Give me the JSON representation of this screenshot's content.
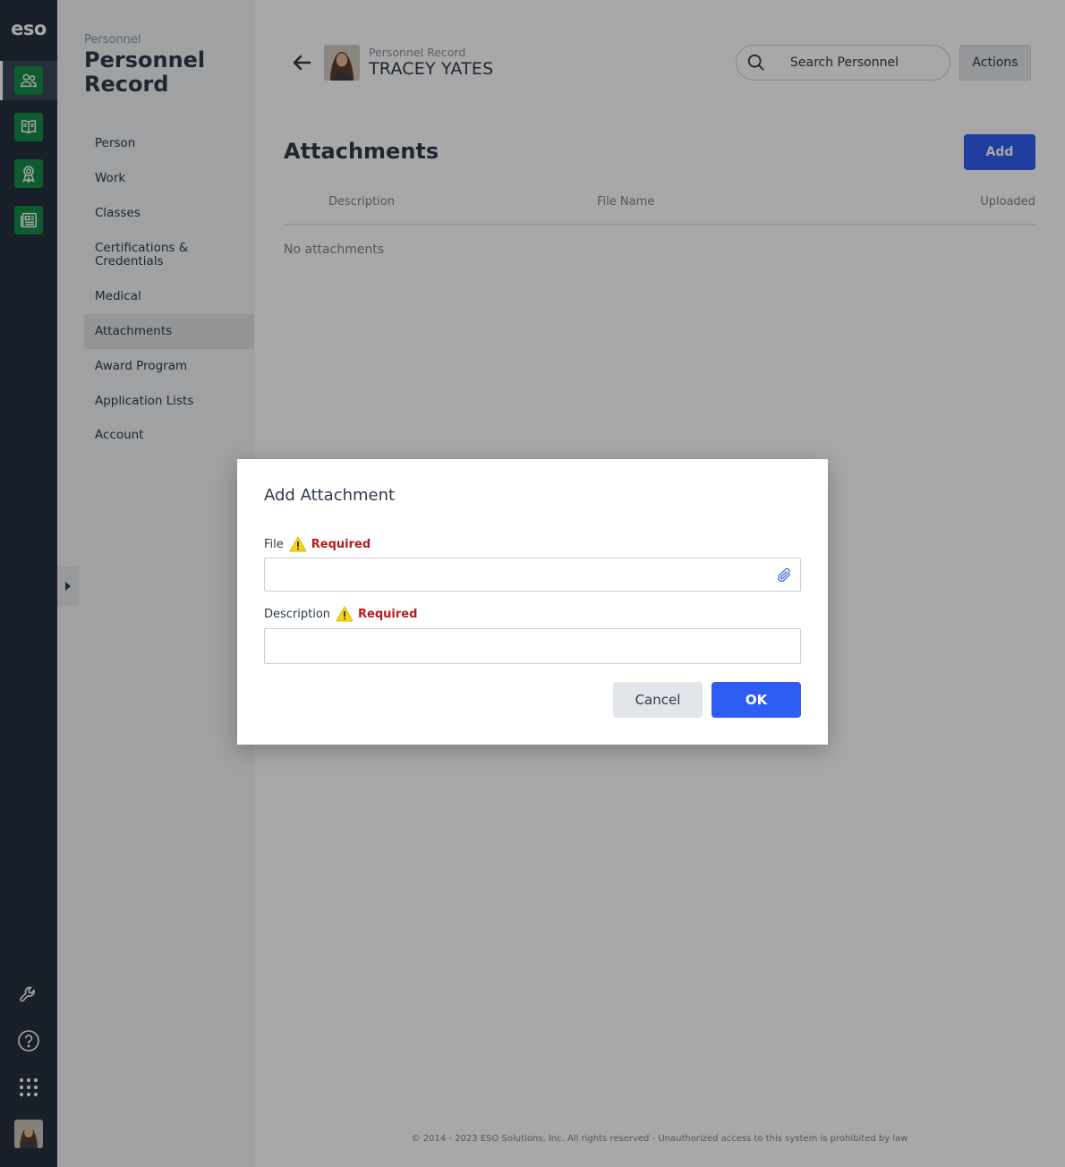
{
  "app": {
    "logo_text": "eso"
  },
  "rail": {
    "items": [
      {
        "icon": "people-icon",
        "active": true
      },
      {
        "icon": "book-icon",
        "active": false
      },
      {
        "icon": "award-icon",
        "active": false
      },
      {
        "icon": "news-icon",
        "active": false
      }
    ],
    "bottom": [
      "wrench-icon",
      "help-icon",
      "apps-grid-icon",
      "user-avatar"
    ]
  },
  "subnav": {
    "eyebrow": "Personnel",
    "title": "Personnel Record",
    "items": [
      {
        "label": "Person"
      },
      {
        "label": "Work"
      },
      {
        "label": "Classes"
      },
      {
        "label": "Certifications & Credentials"
      },
      {
        "label": "Medical"
      },
      {
        "label": "Attachments",
        "active": true
      },
      {
        "label": "Award Program"
      },
      {
        "label": "Application Lists"
      },
      {
        "label": "Account"
      }
    ]
  },
  "header": {
    "eyebrow": "Personnel Record",
    "name": "TRACEY YATES",
    "search_placeholder": "Search Personnel",
    "actions_label": "Actions"
  },
  "main": {
    "title": "Attachments",
    "add_label": "Add",
    "columns": [
      "Description",
      "File Name",
      "Uploaded"
    ],
    "empty_text": "No attachments"
  },
  "footer": {
    "text": "© 2014 - 2023 ESO Solutions, Inc. All rights reserved - Unauthorized access to this system is prohibited by law"
  },
  "modal": {
    "title": "Add Attachment",
    "file_label": "File",
    "file_required": "Required",
    "file_value": "",
    "description_label": "Description",
    "description_required": "Required",
    "description_value": "",
    "cancel_label": "Cancel",
    "ok_label": "OK"
  },
  "colors": {
    "rail_bg": "#25303f",
    "rail_icon_tile": "#148a48",
    "primary_button": "#2f5cf2",
    "required_text": "#b71c1c",
    "warning_yellow": "#f5d90a"
  }
}
